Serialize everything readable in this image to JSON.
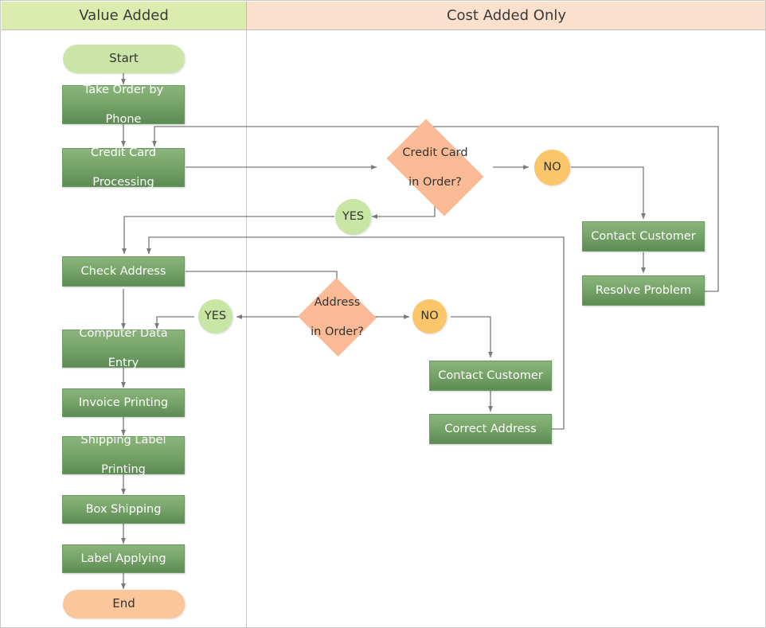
{
  "lanes": {
    "left": {
      "title": "Value Added",
      "color": "#dcebae"
    },
    "right": {
      "title": "Cost Added Only",
      "color": "#fbe0ce"
    }
  },
  "colors": {
    "process_fill_top": "#8ab47c",
    "process_fill_bottom": "#5e8b55",
    "process_text": "#ffffff",
    "decision_fill": "#f9ba95",
    "start_fill": "#cbe5a9",
    "end_fill": "#fbc79a",
    "yes_circle_fill": "#c7e6a4",
    "no_circle_fill": "#fbc569",
    "connector_stroke": "#7a7a7a",
    "lane_divider": "#c9c9c9"
  },
  "nodes": {
    "start": {
      "label": "Start",
      "type": "terminator",
      "lane": "left"
    },
    "take_order": {
      "label": "Take Order by Phone",
      "type": "process",
      "lane": "left"
    },
    "credit_processing": {
      "label": "Credit Card Processing",
      "type": "process",
      "lane": "left"
    },
    "credit_decision": {
      "label": "Credit Card in Order?",
      "type": "decision",
      "lane": "right"
    },
    "credit_no": {
      "label": "NO",
      "type": "connector-circle",
      "lane": "right"
    },
    "credit_yes": {
      "label": "YES",
      "type": "connector-circle",
      "lane": "right"
    },
    "contact_customer_1": {
      "label": "Contact Customer",
      "type": "process",
      "lane": "right"
    },
    "resolve_problem": {
      "label": "Resolve Problem",
      "type": "process",
      "lane": "right"
    },
    "check_address": {
      "label": "Check Address",
      "type": "process",
      "lane": "left"
    },
    "address_decision": {
      "label": "Address in Order?",
      "type": "decision",
      "lane": "right"
    },
    "address_yes": {
      "label": "YES",
      "type": "connector-circle",
      "lane": "right"
    },
    "address_no": {
      "label": "NO",
      "type": "connector-circle",
      "lane": "right"
    },
    "contact_customer_2": {
      "label": "Contact Customer",
      "type": "process",
      "lane": "right"
    },
    "correct_address": {
      "label": "Correct Address",
      "type": "process",
      "lane": "right"
    },
    "computer_entry": {
      "label": "Computer Data Entry",
      "type": "process",
      "lane": "left"
    },
    "invoice_printing": {
      "label": "Invoice Printing",
      "type": "process",
      "lane": "left"
    },
    "shipping_label": {
      "label": "Shipping Label Printing",
      "type": "process",
      "lane": "left"
    },
    "box_shipping": {
      "label": "Box Shipping",
      "type": "process",
      "lane": "left"
    },
    "label_applying": {
      "label": "Label Applying",
      "type": "process",
      "lane": "left"
    },
    "end": {
      "label": "End",
      "type": "terminator",
      "lane": "left"
    }
  },
  "node_labels": {
    "take_order_line1": "Take Order by",
    "take_order_line2": "Phone",
    "credit_processing_line1": "Credit Card",
    "credit_processing_line2": "Processing",
    "credit_decision_line1": "Credit Card",
    "credit_decision_line2": "in Order?",
    "address_decision_line1": "Address",
    "address_decision_line2": "in Order?",
    "computer_entry_line1": "Computer Data",
    "computer_entry_line2": "Entry",
    "shipping_label_line1": "Shipping Label",
    "shipping_label_line2": "Printing"
  }
}
